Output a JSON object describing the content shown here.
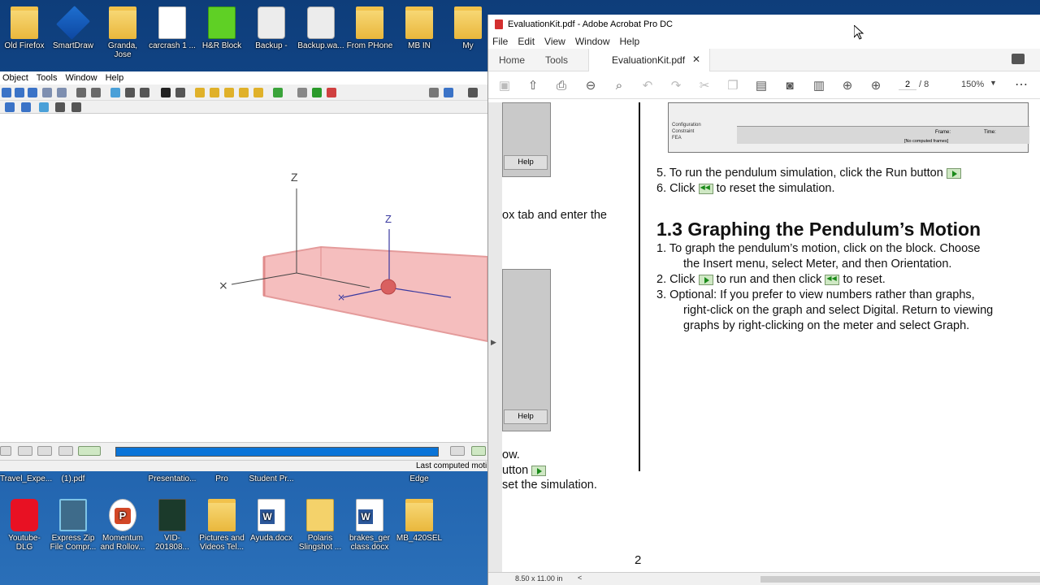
{
  "desktop": {
    "top_icons": [
      {
        "label": "Old Firefox",
        "kind": "folder"
      },
      {
        "label": "SmartDraw",
        "kind": "blue"
      },
      {
        "label": "Granda, Jose",
        "kind": "folder"
      },
      {
        "label": "carcrash 1 ...",
        "kind": "doc"
      },
      {
        "label": "H&R Block",
        "kind": "green"
      },
      {
        "label": "Backup -",
        "kind": "disk"
      },
      {
        "label": "Backup.wa...",
        "kind": "disk"
      },
      {
        "label": "From PHone",
        "kind": "folder"
      },
      {
        "label": "MB IN",
        "kind": "folder"
      },
      {
        "label": "My",
        "kind": "folder"
      }
    ],
    "mid_icons": [
      {
        "label": "Travel_Expe..."
      },
      {
        "label": "(1).pdf"
      },
      {
        "label": "Presentatio..."
      },
      {
        "label": "Pro"
      },
      {
        "label": "Student Pr..."
      },
      {
        "label": "Edge"
      }
    ],
    "bottom_icons": [
      {
        "label": "Youtube-DLG",
        "kind": "red"
      },
      {
        "label": "Express Zip File Compr...",
        "kind": "zip"
      },
      {
        "label": "Momentum and Rollov...",
        "kind": "ppt"
      },
      {
        "label": "VID-201808...",
        "kind": "dark"
      },
      {
        "label": "Pictures and Videos Tel...",
        "kind": "folder"
      },
      {
        "label": "Ayuda.docx",
        "kind": "word"
      },
      {
        "label": "Polaris Slingshot ...",
        "kind": "mail"
      },
      {
        "label": "brakes_ger class.docx",
        "kind": "word"
      },
      {
        "label": "MB_420SEL",
        "kind": "folder"
      }
    ]
  },
  "cad": {
    "menu": [
      "Object",
      "Tools",
      "Window",
      "Help"
    ],
    "axis_z1": "Z",
    "axis_z2": "Z",
    "status_text": "Last computed moti",
    "colors": {
      "block_fill": "#f4b3b3",
      "block_edge": "#e08a8a",
      "ball": "#d96060",
      "timeline": "#0a74d8"
    }
  },
  "acrobat": {
    "title": "EvaluationKit.pdf - Adobe Acrobat Pro DC",
    "menu": [
      "File",
      "Edit",
      "View",
      "Window",
      "Help"
    ],
    "tab_home": "Home",
    "tab_tools": "Tools",
    "tab_doc": "EvaluationKit.pdf",
    "page_current": "2",
    "page_total": "/ 8",
    "zoom": "150%",
    "page_size": "8.50 x 11.00 in",
    "page": {
      "help_1": "Help",
      "help_2": "Help",
      "left_text_1": "ox tab and enter the",
      "left_text_2": "ow.",
      "left_text_3": "utton",
      "left_text_4": "set the simulation.",
      "step5": "5.   To run the pendulum simulation, click the Run button",
      "step6_a": "6.    Click",
      "step6_b": "to reset the simulation.",
      "heading": "1.3 Graphing the Pendulum’s Motion",
      "s1_a": "1.    To graph the pendulum’s motion, click on the block. Choose",
      "s1_b": "the Insert menu, select Meter, and then Orientation.",
      "s2_a": "2.    Click",
      "s2_b": "to run and then click",
      "s2_c": "to reset.",
      "s3_a": "3.    Optional: If you prefer to view numbers rather than graphs,",
      "s3_b": "right-click on the graph and select Digital. Return to viewing",
      "s3_c": "graphs by right-clicking on the meter and select Graph.",
      "page_number": "2",
      "mini_labels": [
        "Configuration",
        "Constraint",
        "FEA",
        "Frame:",
        "Time:",
        "[No computed frames]"
      ]
    }
  }
}
